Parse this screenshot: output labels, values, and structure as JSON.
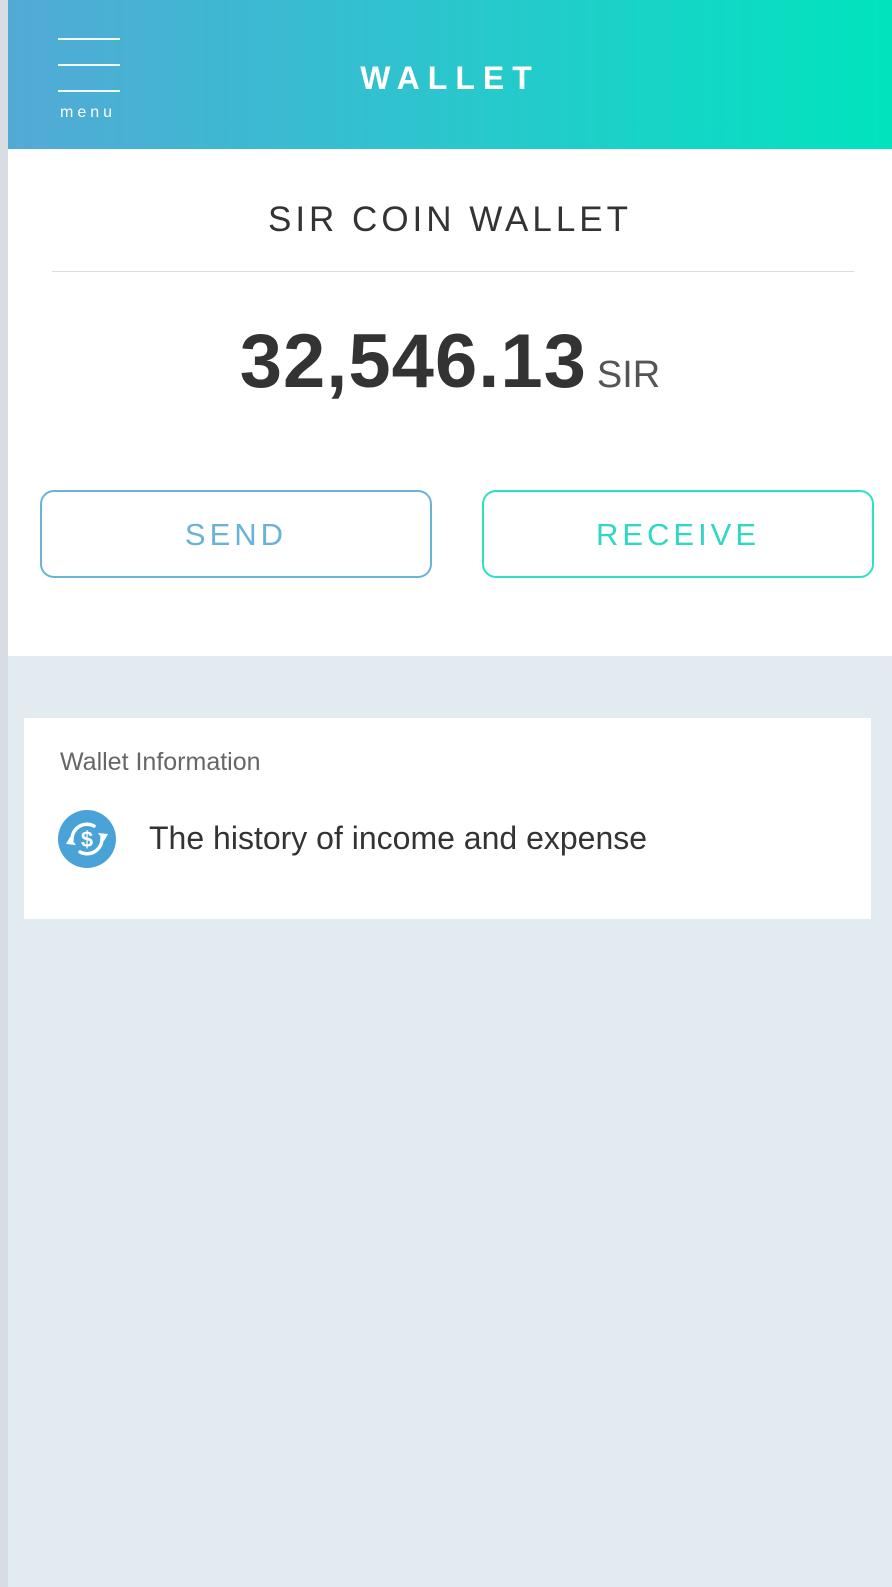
{
  "header": {
    "menu_label": "menu",
    "title": "WALLET"
  },
  "wallet": {
    "title": "SIR COIN WALLET",
    "balance": "32,546.13",
    "unit": "SIR"
  },
  "actions": {
    "send_label": "SEND",
    "receive_label": "RECEIVE"
  },
  "info": {
    "heading": "Wallet Information",
    "history_label": "The history of income and expense",
    "history_icon": "currency-exchange-icon"
  },
  "colors": {
    "header_gradient_start": "#53a9d6",
    "header_gradient_end": "#00e4be",
    "send_accent": "#6ab3d6",
    "receive_accent": "#2ee0c6",
    "lower_background": "#e2ebef",
    "icon_circle": "#4aa3d6"
  }
}
